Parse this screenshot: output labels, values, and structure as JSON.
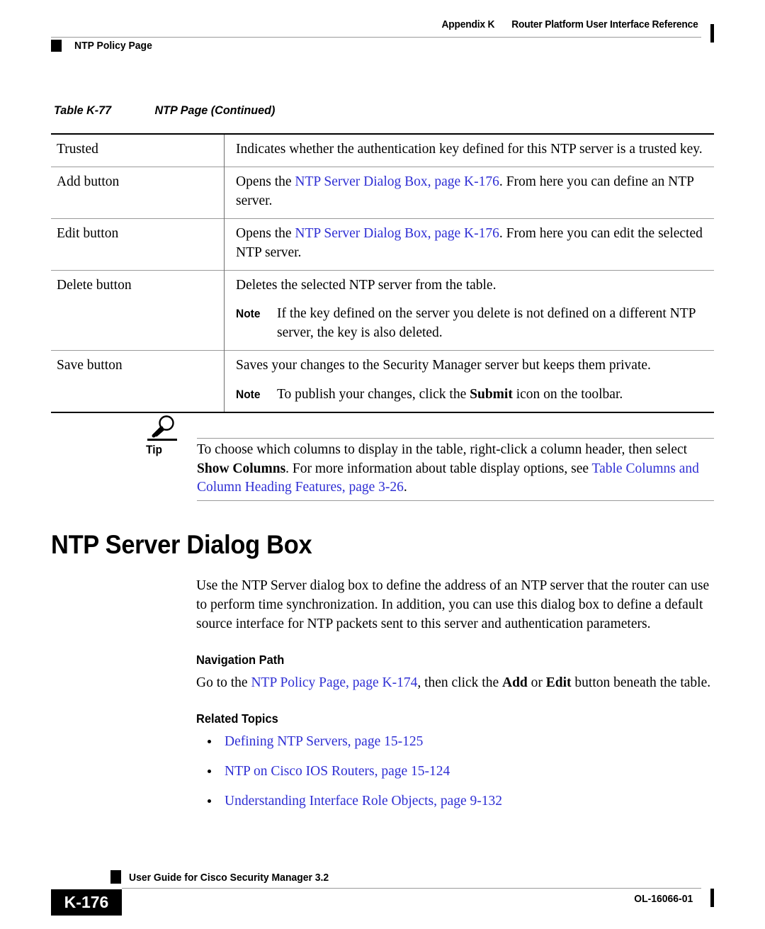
{
  "header": {
    "appendix": "Appendix K",
    "title": "Router Platform User Interface Reference",
    "section_label": "NTP Policy Page",
    "square_icon": "black-square-marker",
    "change_bar": "change-bar-marker"
  },
  "table_caption": {
    "number": "Table K-77",
    "title": "NTP Page (Continued)"
  },
  "table": {
    "rows": [
      {
        "term": "Trusted",
        "description": "Indicates whether the authentication key defined for this NTP server is a trusted key."
      },
      {
        "term": "Add button",
        "desc_before": "Opens the ",
        "link": "NTP Server Dialog Box, page K-176",
        "desc_after": ". From here you can define an NTP server."
      },
      {
        "term": "Edit button",
        "desc_before": "Opens the ",
        "link": "NTP Server Dialog Box, page K-176",
        "desc_after": ". From here you can edit the selected NTP server."
      },
      {
        "term": "Delete button",
        "description": "Deletes the selected NTP server from the table.",
        "note_label": "Note",
        "note_text": "If the key defined on the server you delete is not defined on a different NTP server, the key is also deleted."
      },
      {
        "term": "Save button",
        "description": "Saves your changes to the Security Manager server but keeps them private.",
        "note_label": "Note",
        "note_before": "To publish your changes, click the ",
        "note_bold": "Submit",
        "note_after": " icon on the toolbar."
      }
    ]
  },
  "tip": {
    "icon": "magnifier-tip-icon",
    "label": "Tip",
    "text_before": "To choose which columns to display in the table, right-click a column header, then select ",
    "bold": "Show Columns",
    "text_middle": ". For more information about table display options, see ",
    "link": "Table Columns and Column Heading Features, page 3-26",
    "text_after": "."
  },
  "section": {
    "heading": "NTP Server Dialog Box",
    "intro": "Use the NTP Server dialog box to define the address of an NTP server that the router can use to perform time synchronization. In addition, you can use this dialog box to define a default source interface for NTP packets sent to this server and authentication parameters.",
    "navigation_path": {
      "heading": "Navigation Path",
      "text_before": "Go to the ",
      "link": "NTP Policy Page, page K-174",
      "text_middle": ", then click the ",
      "bold_add": "Add",
      "text_or": " or ",
      "bold_edit": "Edit",
      "text_after": " button beneath the table."
    },
    "related_topics": {
      "heading": "Related Topics",
      "items": [
        "Defining NTP Servers, page 15-125",
        "NTP on Cisco IOS Routers, page 15-124",
        "Understanding Interface Role Objects, page 9-132"
      ]
    }
  },
  "footer": {
    "square_icon": "black-square-marker",
    "guide_title": "User Guide for Cisco Security Manager 3.2",
    "page_number": "K-176",
    "doc_id": "OL-16066-01",
    "change_bar": "change-bar-marker"
  },
  "colors": {
    "link": "#2f2fd4",
    "rule": "#9a9a9a",
    "text": "#000000"
  }
}
